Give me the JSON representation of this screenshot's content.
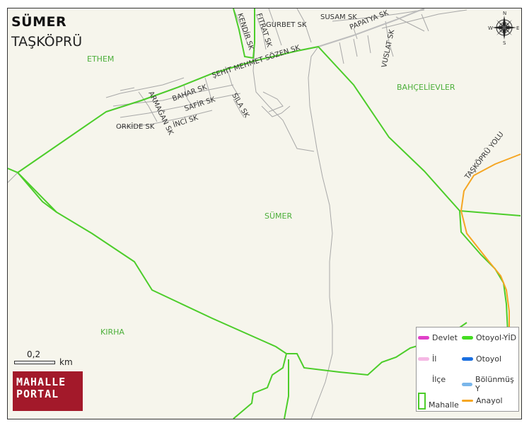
{
  "title": "SÜMER",
  "subtitle": "TAŞKÖPRÜ",
  "areas": {
    "ethem": "ETHEM",
    "bahcelievler": "BAHÇELİEVLER",
    "sumer": "SÜMER",
    "kirha": "KIRHA"
  },
  "streets": {
    "kendir": "KENDİR SK",
    "fitrat": "FITRAT SK",
    "gurbet": "GURBET SK",
    "susam": "SUSAM SK",
    "papatya": "PAPATYA SK",
    "vuslat": "VUSLAT SK",
    "sehit": "ŞEHİT MEHMET SÖZEN SK",
    "bahar": "BAHAR SK",
    "safir": "SAFİR SK",
    "inci": "İNCİ SK",
    "sila": "SILA SK",
    "armagan": "ARMAĞAN SK",
    "orkide": "ORKİDE SK",
    "taskopru_yolu": "TAŞKÖPRÜ YOLU"
  },
  "scale": {
    "value": "0,2",
    "unit": "km"
  },
  "logo": {
    "line1": "MAHALLE",
    "line2": "PORTAL"
  },
  "compass": {
    "n": "N",
    "s": "S",
    "e": "E",
    "w": "W"
  },
  "legend": {
    "items": [
      {
        "label": "Devlet",
        "color": "#e040c8"
      },
      {
        "label": "Otoyol-YİD",
        "color": "#44dd22"
      },
      {
        "label": "İl",
        "color": "#f5b8e4"
      },
      {
        "label": "Otoyol",
        "color": "#1a6fe0"
      },
      {
        "label": "İlçe",
        "color": "#ffffff"
      },
      {
        "label": "Bölünmüş Y",
        "color": "#7ab6ea"
      },
      {
        "label": "Mahalle",
        "color": "#4ccd2a"
      },
      {
        "label": "Anayol",
        "color": "#f5a623"
      }
    ]
  }
}
